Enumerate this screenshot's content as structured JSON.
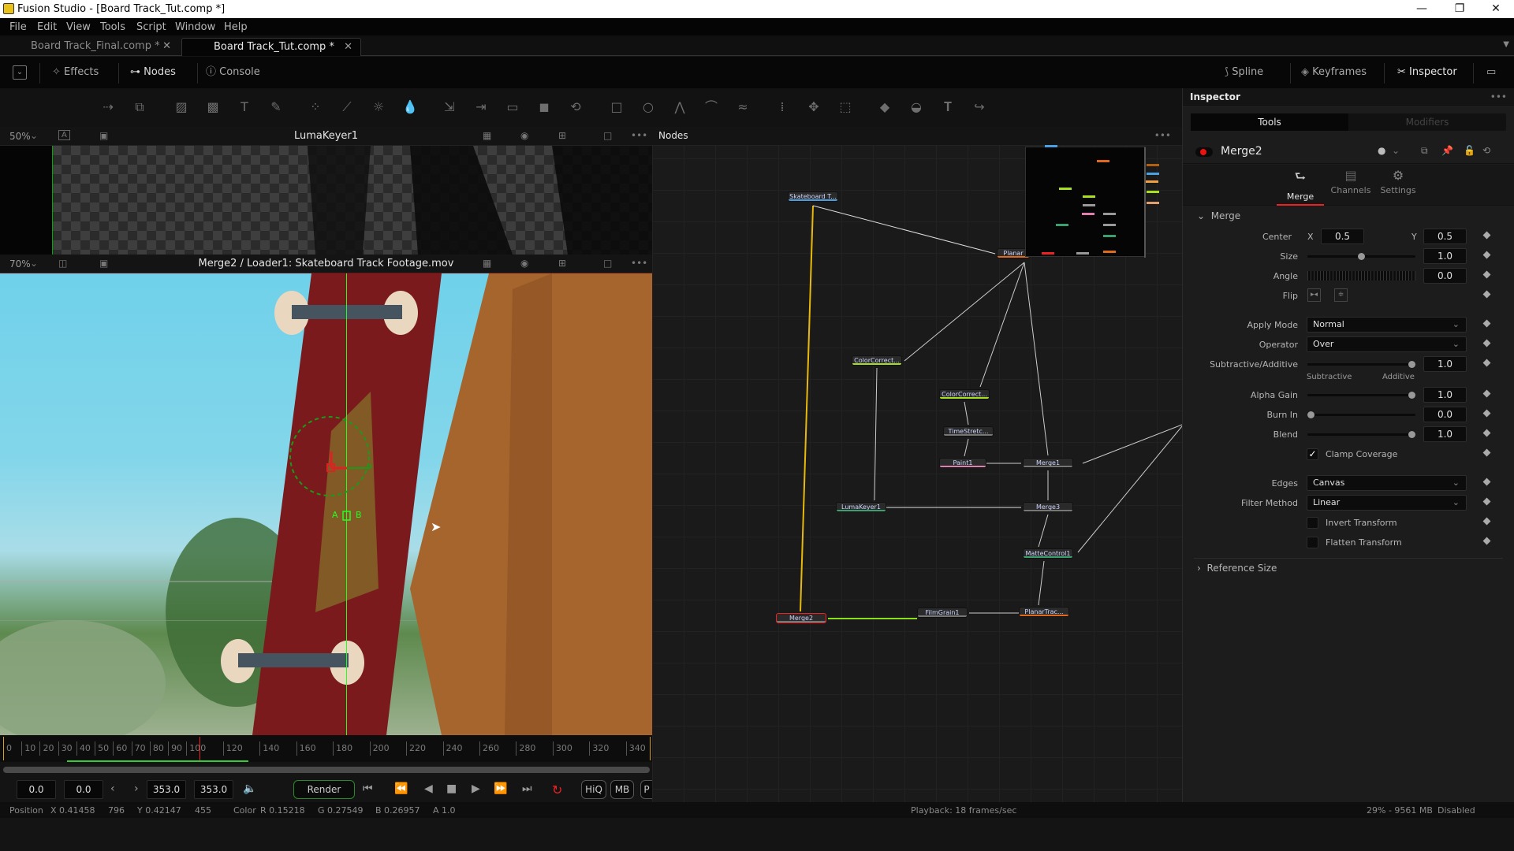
{
  "window": {
    "title": "Fusion Studio - [Board Track_Tut.comp *]",
    "minimize": "—",
    "restore": "❐",
    "close": "✕"
  },
  "menu": [
    "File",
    "Edit",
    "View",
    "Tools",
    "Script",
    "Window",
    "Help"
  ],
  "comp_tabs": [
    {
      "label": "Board Track_Final.comp *",
      "active": false
    },
    {
      "label": "Board Track_Tut.comp *",
      "active": true
    }
  ],
  "toolbar": {
    "left": [
      {
        "label": "Effects",
        "icon": "magic-wand-icon"
      },
      {
        "label": "Nodes",
        "icon": "nodes-icon"
      },
      {
        "label": "Console",
        "icon": "info-icon"
      }
    ],
    "right": [
      {
        "label": "Spline",
        "icon": "spline-icon"
      },
      {
        "label": "Keyframes",
        "icon": "keyframes-icon"
      },
      {
        "label": "Inspector",
        "icon": "inspector-icon"
      }
    ]
  },
  "tool_icons": [
    "background",
    "merge",
    "text",
    "paint",
    "particles",
    "curves",
    "brightness",
    "blur",
    "transform",
    "crop",
    "resize",
    "matte",
    "letterbox",
    "rectangle",
    "ellipse",
    "polygon",
    "bspline",
    "bitmap",
    "tracker",
    "planar",
    "planar-transform",
    "shape3d",
    "text3d",
    "merge3d",
    "render3d",
    "camera3d",
    "light3d"
  ],
  "viewer1": {
    "zoom": "50%",
    "title": "LumaKeyer1"
  },
  "viewer2": {
    "zoom": "70%",
    "title": "Merge2 / Loader1: Skateboard Track Footage.mov",
    "overlay_labels": {
      "a": "A",
      "b": "B"
    }
  },
  "timeline": {
    "ticks": [
      "0",
      "10",
      "20",
      "30",
      "40",
      "50",
      "60",
      "70",
      "80",
      "90",
      "100",
      "120",
      "140",
      "160",
      "180",
      "200",
      "220",
      "240",
      "260",
      "280",
      "300",
      "320",
      "340"
    ],
    "current_frame": 107,
    "range": [
      0,
      353
    ]
  },
  "transport": {
    "global_start": "0.0",
    "render_start": "0.0",
    "render_end": "353.0",
    "global_end": "353.0",
    "render_label": "Render",
    "hiq_label": "HiQ",
    "mb_label": "MB",
    "prx_label": "P"
  },
  "status": {
    "position_label": "Position",
    "x": "X 0.41458",
    "px": "796",
    "y": "Y 0.42147",
    "py": "455",
    "color_label": "Color",
    "r": "R 0.15218",
    "g": "G 0.27549",
    "b": "B 0.26957",
    "a": "A 1.0",
    "playback": "Playback: 18 frames/sec",
    "memory": "29% - 9561 MB",
    "state": "Disabled"
  },
  "nodes_panel": {
    "title": "Nodes",
    "nodes": [
      {
        "id": "skateboard",
        "label": "Skateboard T...",
        "color": "#4aa0e0"
      },
      {
        "id": "planar",
        "label": "Planar",
        "color": "#e06a1a"
      },
      {
        "id": "cc1",
        "label": "ColorCorrect...",
        "color": "#a8e020"
      },
      {
        "id": "cc2",
        "label": "ColorCorrect...",
        "color": "#a8e020"
      },
      {
        "id": "timestretch",
        "label": "TimeStretc...",
        "color": "#777"
      },
      {
        "id": "paint1",
        "label": "Paint1",
        "color": "#e080b0"
      },
      {
        "id": "merge1",
        "label": "Merge1",
        "color": "#777"
      },
      {
        "id": "lumakeyer1",
        "label": "LumaKeyer1",
        "color": "#3aa070"
      },
      {
        "id": "merge3",
        "label": "Merge3",
        "color": "#777"
      },
      {
        "id": "mattecontrol1",
        "label": "MatteControl1",
        "color": "#3aa070"
      },
      {
        "id": "merge2",
        "label": "Merge2",
        "color": "#777"
      },
      {
        "id": "filmgrain1",
        "label": "FilmGrain1",
        "color": "#777"
      },
      {
        "id": "planartrack",
        "label": "PlanarTrac...",
        "color": "#e06a1a"
      }
    ]
  },
  "inspector": {
    "title": "Inspector",
    "tabs": [
      "Tools",
      "Modifiers"
    ],
    "tool_name": "Merge2",
    "subtabs": [
      "Merge",
      "Channels",
      "Settings"
    ],
    "section": "Merge",
    "center": {
      "label": "Center",
      "x_label": "X",
      "x": "0.5",
      "y_label": "Y",
      "y": "0.5"
    },
    "size": {
      "label": "Size",
      "value": "1.0",
      "slider": 0.5
    },
    "angle": {
      "label": "Angle",
      "value": "0.0"
    },
    "flip": {
      "label": "Flip"
    },
    "apply_mode": {
      "label": "Apply Mode",
      "value": "Normal"
    },
    "operator": {
      "label": "Operator",
      "value": "Over"
    },
    "sub_add": {
      "label": "Subtractive/Additive",
      "value": "1.0",
      "slider": 1.0,
      "left": "Subtractive",
      "right": "Additive"
    },
    "alpha_gain": {
      "label": "Alpha Gain",
      "value": "1.0",
      "slider": 1.0
    },
    "burn_in": {
      "label": "Burn In",
      "value": "0.0",
      "slider": 0.0
    },
    "blend": {
      "label": "Blend",
      "value": "1.0",
      "slider": 1.0
    },
    "clamp": {
      "label": "Clamp Coverage",
      "checked": true
    },
    "edges": {
      "label": "Edges",
      "value": "Canvas"
    },
    "filter": {
      "label": "Filter Method",
      "value": "Linear"
    },
    "invert": {
      "label": "Invert Transform",
      "checked": false
    },
    "flatten": {
      "label": "Flatten Transform",
      "checked": false
    },
    "ref_section": "Reference Size"
  }
}
